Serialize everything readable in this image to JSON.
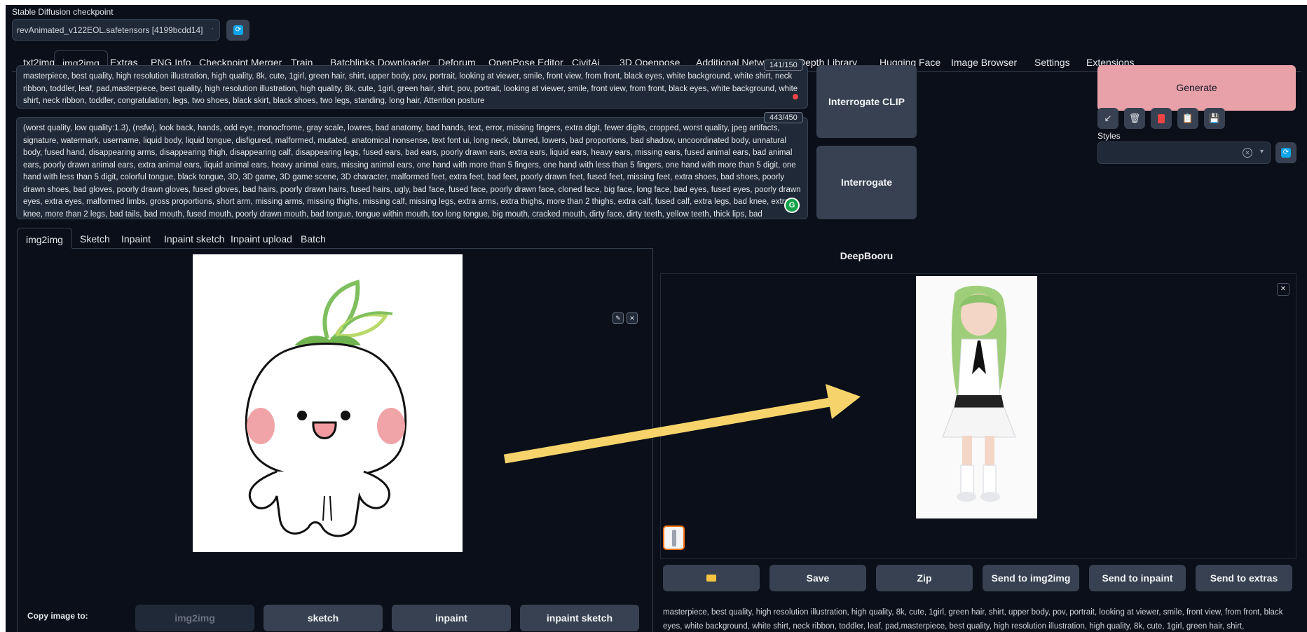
{
  "checkpoint": {
    "label": "Stable Diffusion checkpoint",
    "value": "revAnimated_v122EOL.safetensors [4199bcdd14]"
  },
  "tabs": [
    "txt2img",
    "img2img",
    "Extras",
    "PNG Info",
    "Checkpoint Merger",
    "Train",
    "Batchlinks Downloader",
    "Deforum",
    "OpenPose Editor",
    "CivitAi",
    "3D Openpose",
    "Additional Networks",
    "Depth Library",
    "Hugging Face",
    "Image Browser",
    "Settings",
    "Extensions"
  ],
  "active_tab": "img2img",
  "prompt": {
    "counter": "141/150",
    "text": "masterpiece, best quality, high resolution illustration, high quality, 8k, cute, 1girl, green hair, shirt, upper body, pov, portrait, looking at viewer, smile, front view, from front, black eyes, white background, white shirt, neck ribbon, toddler, leaf, pad,masterpiece, best quality, high resolution illustration, high quality, 8k, cute, 1girl, green hair, shirt, pov, portrait, looking at viewer, smile, front view, from front, black eyes, white background, white shirt, neck ribbon, toddler, congratulation, legs, two shoes,  black skirt, black shoes, two legs, standing, long hair, Attention posture"
  },
  "negative_prompt": {
    "counter": "443/450",
    "text": "(worst quality, low quality:1.3), (nsfw),  look back, hands, odd eye, monocfrome, gray scale, lowres, bad anatomy, bad hands, text, error, missing fingers, extra digit, fewer digits, cropped, worst quality, jpeg artifacts, signature, watermark, username, liquid body, liquid tongue, disfigured, malformed, mutated, anatomical nonsense, text font ui, long neck, blurred, lowers, bad proportions, bad shadow, uncoordinated body, unnatural body, fused hand, disappearing arms, disappearing thigh, disappearing calf, disappearing legs, fused ears, bad ears, poorly drawn ears, extra ears, liquid ears, heavy ears, missing ears, fused animal ears, bad animal ears, poorly drawn animal ears, extra animal ears, liquid animal ears, heavy animal ears, missing animal ears, one hand with more than 5 fingers, one hand with less than 5 fingers, one hand with more than 5 digit, one hand with less than 5 digit, colorful tongue, black tongue, 3D, 3D game, 3D game scene, 3D character, malformed feet, extra feet, bad feet, poorly drawn feet, fused feet, missing feet, extra shoes, bad shoes, poorly drawn shoes, bad gloves, poorly drawn gloves, fused gloves, bad hairs, poorly drawn hairs, fused hairs, ugly, bad face, fused face, poorly drawn face, cloned face, big face, long face, bad eyes, fused eyes, poorly drawn eyes, extra eyes, malformed limbs, gross proportions, short arm, missing arms, missing thighs, missing calf, missing legs, extra arms, extra thighs, more than 2 thighs, extra calf, fused calf, extra legs, bad knee, extra knee, more than 2 legs, bad tails, bad mouth, fused mouth, poorly drawn mouth, bad tongue, tongue within mouth, too long tongue, big mouth, cracked mouth, dirty face, dirty teeth, yellow teeth, thick lips, bad collarbone, fused collarbone, missing collarbone, liquid collarbone, QR code, bar code, pubic hair, mosaic, excrement, blurry, background, sitting,"
  },
  "buttons": {
    "interrogate_clip": "Interrogate CLIP",
    "interrogate_deepbooru": "Interrogate DeepBooru",
    "generate": "Generate"
  },
  "tool_icons": [
    "arrow-icon",
    "trash-icon",
    "bookmark-icon",
    "clipboard-icon",
    "save-icon"
  ],
  "styles": {
    "label": "Styles"
  },
  "subtabs": [
    "img2img",
    "Sketch",
    "Inpaint",
    "Inpaint sketch",
    "Inpaint upload",
    "Batch"
  ],
  "active_subtab": "img2img",
  "copy_image": {
    "label": "Copy image to:",
    "buttons": [
      "img2img",
      "sketch",
      "inpaint",
      "inpaint sketch"
    ]
  },
  "output_buttons": [
    "Save",
    "Zip",
    "Send to img2img",
    "Send to inpaint",
    "Send to extras"
  ],
  "output_text": "masterpiece, best quality, high resolution illustration, high quality, 8k, cute, 1girl, green hair, shirt, upper body, pov, portrait, looking at viewer, smile, front view, from front, black eyes, white background, white shirt, neck ribbon, toddler, leaf, pad,masterpiece, best quality, high resolution illustration, high quality, 8k, cute, 1girl, green hair, shirt,",
  "colors": {
    "background": "#0b0f19",
    "panel": "#1f2937",
    "button": "#374151",
    "generate": "#e8a0a9",
    "accent_blue": "#0ea5e9",
    "arrow": "#f7d46b",
    "thumb_border": "#f97316"
  }
}
